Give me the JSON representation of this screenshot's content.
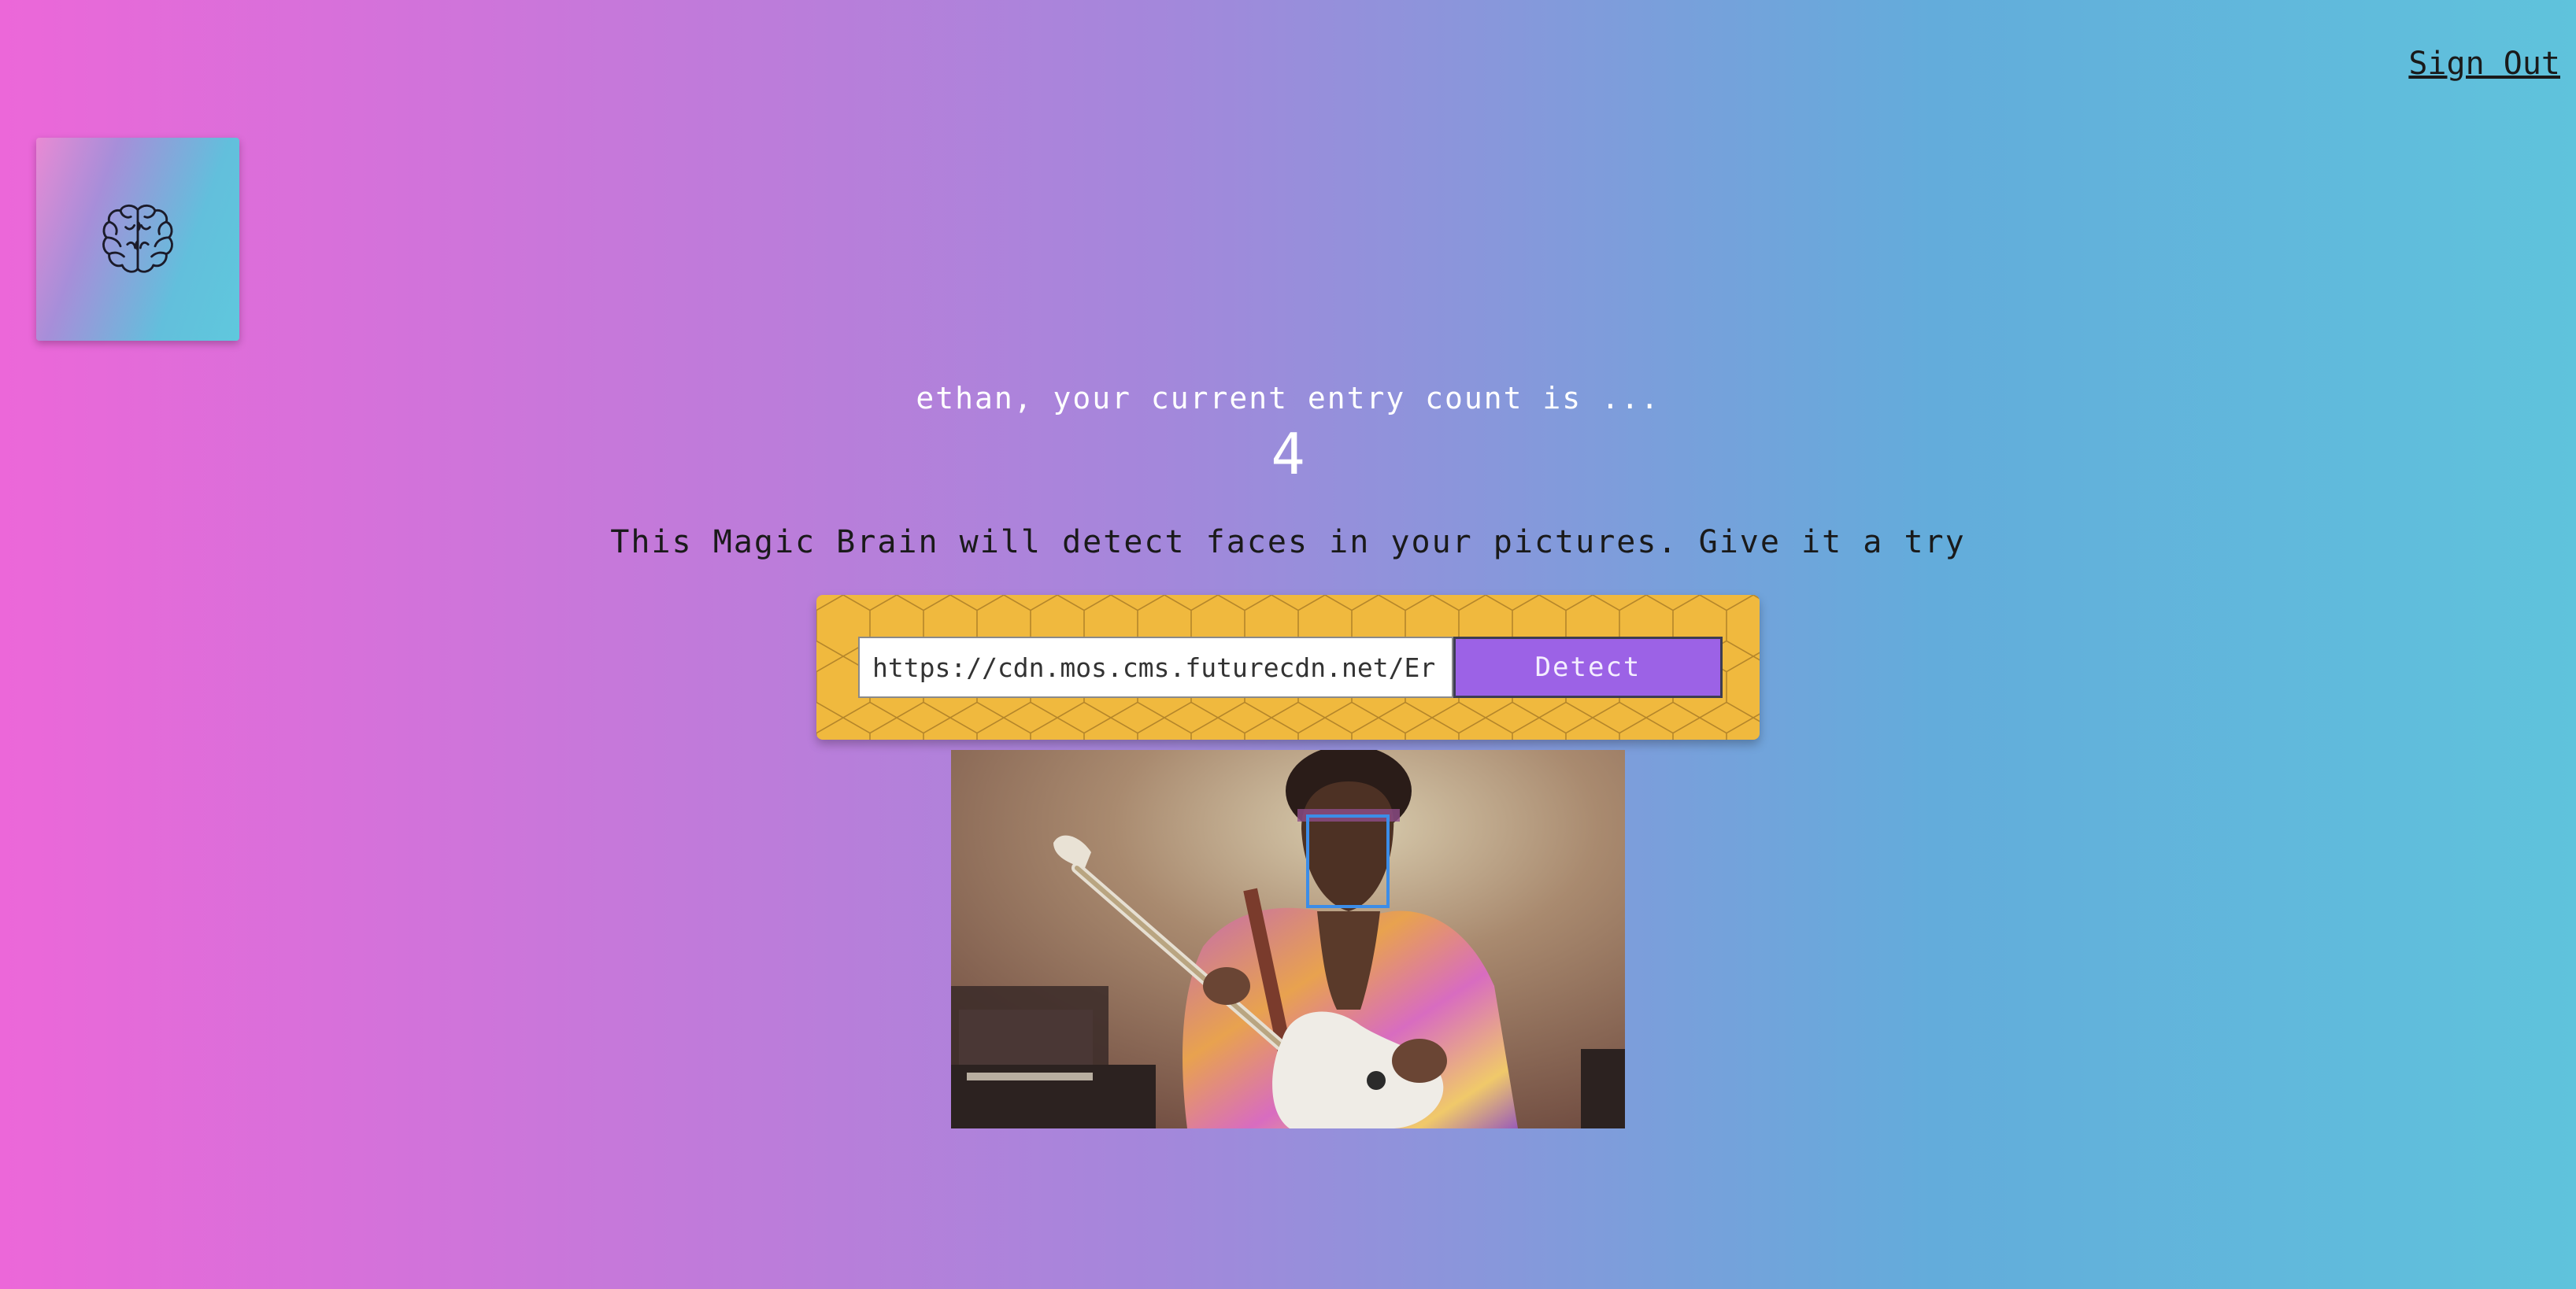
{
  "nav": {
    "sign_out_label": "Sign Out"
  },
  "logo": {
    "icon": "brain-icon",
    "gradient": [
      "#e98ad4",
      "#5fc8dd"
    ]
  },
  "rank": {
    "message": "ethan, your current entry count is ...",
    "count": "4"
  },
  "intro": {
    "text": "This Magic Brain will detect faces in your pictures. Give it a try"
  },
  "form": {
    "url_value": "https://cdn.mos.cms.futurecdn.net/Er",
    "detect_label": "Detect",
    "panel_color": "#f0b93e",
    "button_color": "#9c62e6"
  },
  "result": {
    "image_description_icon": "photo-guitarist",
    "face_box_color": "#3c8de8"
  },
  "theme": {
    "background_gradient": [
      "#ec67d9",
      "#a487db",
      "#63acdb",
      "#5fc3dc"
    ]
  }
}
